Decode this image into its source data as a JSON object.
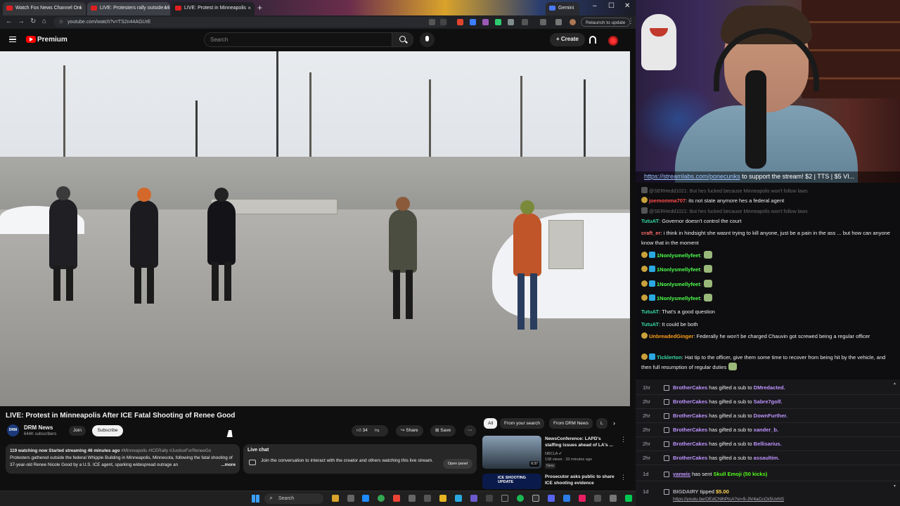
{
  "browser": {
    "tabs": [
      {
        "title": "Watch Fox News Channel Onl"
      },
      {
        "title": "LIVE: Protesters rally outside Mi"
      },
      {
        "title": "LIVE: Protest in Minneapolis"
      },
      {
        "title": "Gemini"
      }
    ],
    "url": "youtube.com/watch?v=TS2n44AGUrE",
    "relaunch_label": "Relaunch to update"
  },
  "youtube": {
    "brand": "Premium",
    "search_placeholder": "Search",
    "create_label": "Create",
    "video": {
      "title": "LIVE: Protest in Minneapolis After ICE Fatal Shooting of Renee Good",
      "channel": "DRM News",
      "channel_avatar_text": "DRM",
      "subscribers": "644K subscribers",
      "join_label": "Join",
      "subscribe_label": "Subscribe",
      "likes": "34",
      "share_label": "Share",
      "save_label": "Save"
    },
    "description": {
      "meta": "119 watching now  Started streaming 46 minutes ago",
      "tags": " #Minneapolis #ICERally #JusticeForReneeGo",
      "text": "Protesters gathered outside the federal Whipple Building in Minneapolis, Minnesota, following the fatal shooting of 37-year-old Renee Nicole Good by a U.S. ICE agent, sparking widespread outrage an",
      "more_label": "...more"
    },
    "live_chat": {
      "title": "Live chat",
      "text": "Join the conversation to interact with the creator and others watching this live stream.",
      "open_panel_label": "Open panel"
    },
    "chips": [
      "All",
      "From your search",
      "From DRM News",
      "L"
    ],
    "recommendations": [
      {
        "title": "NewsConference: LAPD's staffing issues ahead of LA's ...",
        "channel": "NBCLA",
        "meta": "138 views · 33 minutes ago",
        "badge": "New",
        "duration": "6:37"
      },
      {
        "title": "Prosecutor asks public to share ICE shooting evidence",
        "thumb_text": "ICE SHOOTING UPDATE"
      }
    ]
  },
  "taskbar": {
    "search_label": "Search"
  },
  "stream": {
    "banner_link": "https://streamlabs.com/ponecunks",
    "banner_text": " to support the stream! $2 | TTS | $5 VI..."
  },
  "twitch_chat": {
    "messages": [
      {
        "name": "@SERHedd1021",
        "text": ": But hes fucked because Minneapolis won't follow laws",
        "faded": true
      },
      {
        "name": "joemomma707",
        "text": ": its not state anymore hes a federal agent",
        "color": "#ff4d4d"
      },
      {
        "name": "@SERHedd1021",
        "text": ": But hes fucked because Minneapolis won't follow laws",
        "faded": true
      },
      {
        "name": "TutuAT",
        "text": ": Governor doesn't control the court",
        "color": "#36d6a0"
      },
      {
        "name": "craft_er",
        "text": ": i think in hindsight she wasnt trying to kill anyone, just be a pain in the ass ... but how can anyone know that in the moment",
        "color": "#ff6b6b"
      },
      {
        "name": "1Nonlysmellyfeet",
        "text": ":",
        "color": "#4dff4d"
      },
      {
        "name": "1Nonlysmellyfeet",
        "text": ":",
        "color": "#4dff4d"
      },
      {
        "name": "1Nonlysmellyfeet",
        "text": ":",
        "color": "#4dff4d"
      },
      {
        "name": "1Nonlysmellyfeet",
        "text": ":",
        "color": "#4dff4d"
      },
      {
        "name": "TutuAT",
        "text": ": That's a good question",
        "color": "#36d6a0"
      },
      {
        "name": "TutuAT",
        "text": ": It could be both",
        "color": "#36d6a0"
      },
      {
        "name": "UnbreadedGinger",
        "text": ": Federally he won't be charged Chauvin got screwed being a regular officer",
        "color": "#ff9f1a"
      },
      {
        "name": "Ticklerton",
        "text": ": Hat tip to the officer, give them some time to recover from being hit by the vehicle, and then full resumption of regular duties",
        "color": "#36d6a0"
      }
    ]
  },
  "events": [
    {
      "time": "1hr",
      "user": "BrotherCakes",
      "text": " has gifted a sub to ",
      "target": "DMredacted."
    },
    {
      "time": "2hr",
      "user": "BrotherCakes",
      "text": " has gifted a sub to ",
      "target": "Sabre7golf."
    },
    {
      "time": "2hr",
      "user": "BrotherCakes",
      "text": " has gifted a sub to ",
      "target": "DownFurther."
    },
    {
      "time": "2hr",
      "user": "BrotherCakes",
      "text": " has gifted a sub to ",
      "target": "xander_b."
    },
    {
      "time": "2hr",
      "user": "BrotherCakes",
      "text": " has gifted a sub to ",
      "target": "Bellisarius."
    },
    {
      "time": "2hr",
      "user": "BrotherCakes",
      "text": " has gifted a sub to ",
      "target": "assaultim."
    },
    {
      "time": "1d",
      "user": "yanwic",
      "text": " has sent ",
      "target": "Skull Emoji (50 kicks)"
    },
    {
      "time": "1d",
      "user": "BIGDAIRY",
      "text": " tipped ",
      "target": "$5.00",
      "link": "https://youtu.be/OEdCNlhPtcA?si=9-JlV4aCcCk5UxNS"
    }
  ]
}
